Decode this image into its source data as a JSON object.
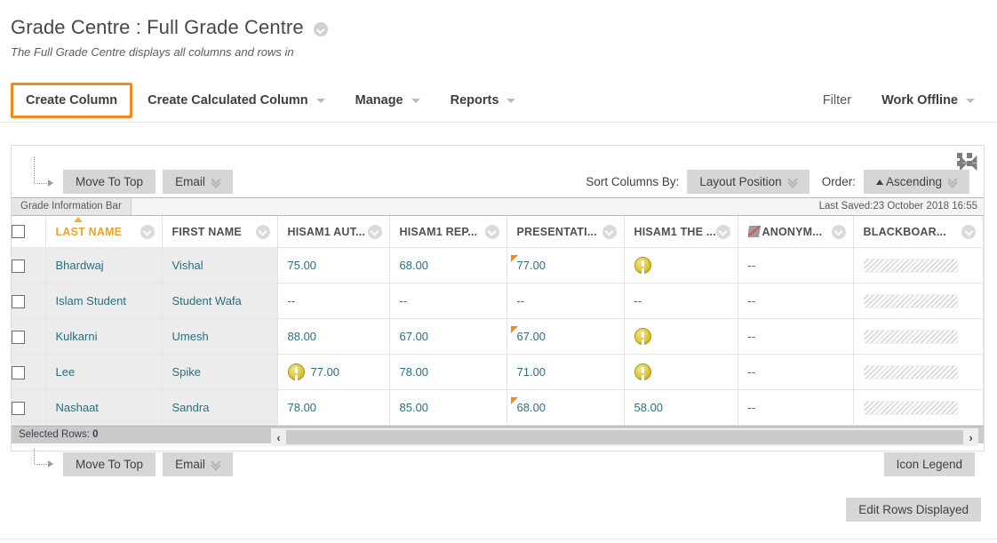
{
  "page": {
    "title": "Grade Centre : Full Grade Centre",
    "subtitle": "The Full Grade Centre displays all columns and rows in"
  },
  "action_bar": {
    "left_items": [
      {
        "label": "Create Column",
        "has_caret": false,
        "highlighted": true
      },
      {
        "label": "Create Calculated Column",
        "has_caret": true,
        "highlighted": false
      },
      {
        "label": "Manage",
        "has_caret": true,
        "highlighted": false
      },
      {
        "label": "Reports",
        "has_caret": true,
        "highlighted": false
      }
    ],
    "right_items": [
      {
        "label": "Filter",
        "has_caret": false,
        "bold": false
      },
      {
        "label": "Work Offline",
        "has_caret": true,
        "bold": true
      }
    ]
  },
  "toolbar": {
    "move_to_top_label": "Move To Top",
    "email_label": "Email",
    "sort_columns_by_label": "Sort Columns By:",
    "sort_columns_by_value": "Layout Position",
    "order_label": "Order:",
    "order_value": "Ascending"
  },
  "info_bar": {
    "grade_information_bar": "Grade Information Bar",
    "last_saved": "Last Saved:23 October 2018 16:55"
  },
  "table": {
    "columns": [
      {
        "label": "LAST NAME",
        "sorted": true,
        "hidden_icon": false
      },
      {
        "label": "FIRST NAME",
        "sorted": false,
        "hidden_icon": false
      },
      {
        "label": "HISAM1 AUT...",
        "sorted": false,
        "hidden_icon": false
      },
      {
        "label": "HISAM1 REP...",
        "sorted": false,
        "hidden_icon": false
      },
      {
        "label": "PRESENTATI...",
        "sorted": false,
        "hidden_icon": false
      },
      {
        "label": "HISAM1 THE ...",
        "sorted": false,
        "hidden_icon": false
      },
      {
        "label": "ANONYM...",
        "sorted": false,
        "hidden_icon": true
      },
      {
        "label": "BLACKBOAR...",
        "sorted": false,
        "hidden_icon": false
      }
    ],
    "rows": [
      {
        "last_name": "Bhardwaj",
        "first_name": "Vishal",
        "hisam1_aut": "75.00",
        "hisam1_aut_icon": "",
        "hisam1_rep": "68.00",
        "presentation": "77.00",
        "presentation_flag": true,
        "hisam1_the": "",
        "hisam1_the_icon": "needs-grading",
        "anonymous": "--",
        "blackboard": "hatch"
      },
      {
        "last_name": "Islam Student",
        "first_name": "Student Wafa",
        "hisam1_aut": "--",
        "hisam1_aut_icon": "",
        "hisam1_rep": "--",
        "presentation": "--",
        "presentation_flag": false,
        "hisam1_the": "--",
        "hisam1_the_icon": "",
        "anonymous": "--",
        "blackboard": "hatch"
      },
      {
        "last_name": "Kulkarni",
        "first_name": "Umesh",
        "hisam1_aut": "88.00",
        "hisam1_aut_icon": "",
        "hisam1_rep": "67.00",
        "presentation": "67.00",
        "presentation_flag": true,
        "hisam1_the": "",
        "hisam1_the_icon": "needs-grading",
        "anonymous": "--",
        "blackboard": "hatch"
      },
      {
        "last_name": "Lee",
        "first_name": "Spike",
        "hisam1_aut": "77.00",
        "hisam1_aut_icon": "needs-grading",
        "hisam1_rep": "78.00",
        "presentation": "71.00",
        "presentation_flag": false,
        "hisam1_the": "",
        "hisam1_the_icon": "needs-grading",
        "anonymous": "--",
        "blackboard": "hatch"
      },
      {
        "last_name": "Nashaat",
        "first_name": "Sandra",
        "hisam1_aut": "78.00",
        "hisam1_aut_icon": "",
        "hisam1_rep": "85.00",
        "presentation": "68.00",
        "presentation_flag": true,
        "hisam1_the": "58.00",
        "hisam1_the_icon": "",
        "anonymous": "--",
        "blackboard": "hatch"
      }
    ]
  },
  "status": {
    "selected_rows_label": "Selected Rows:",
    "selected_rows_count": "0",
    "scroll_left_glyph": "‹",
    "scroll_right_glyph": "›"
  },
  "footer": {
    "icon_legend_label": "Icon Legend",
    "edit_rows_displayed_label": "Edit Rows Displayed"
  },
  "colors": {
    "highlight": "#ef8b1f",
    "sorted_header": "#e7a52b",
    "link": "#2a6e7c"
  }
}
